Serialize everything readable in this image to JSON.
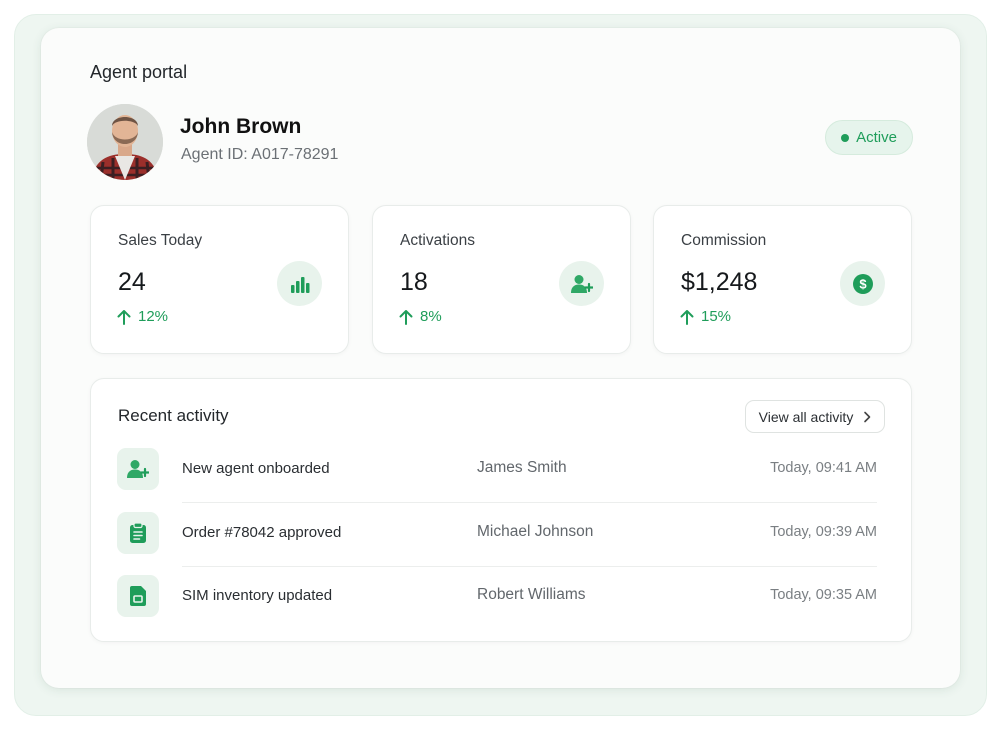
{
  "portal": {
    "title": "Agent portal"
  },
  "agent": {
    "name": "John Brown",
    "agent_id": "Agent ID: A017-78291",
    "status": "Active",
    "avatar_icon": "user-photo"
  },
  "stats": [
    {
      "label": "Sales Today",
      "value": "24",
      "change": "12%",
      "trend_icon": "arrow-up-icon",
      "icon": "bar-chart-icon"
    },
    {
      "label": "Activations",
      "value": "18",
      "change": "8%",
      "trend_icon": "arrow-up-icon",
      "icon": "user-plus-icon"
    },
    {
      "label": "Commission",
      "value": "$1,248",
      "change": "15%",
      "trend_icon": "arrow-up-icon",
      "icon": "dollar-icon"
    }
  ],
  "activity": {
    "title": "Recent activity",
    "view_all_label": "View all activity",
    "items": [
      {
        "event": "New agent onboarded",
        "person": "James Smith",
        "time": "Today, 09:41 AM",
        "icon": "user-plus-icon"
      },
      {
        "event": "Order #78042 approved",
        "person": "Michael Johnson",
        "time": "Today, 09:39 AM",
        "icon": "clipboard-icon"
      },
      {
        "event": "SIM inventory updated",
        "person": "Robert Williams",
        "time": "Today, 09:35 AM",
        "icon": "sim-card-icon"
      }
    ]
  },
  "colors": {
    "accent": "#1f9d5a",
    "accent_bg": "#e8f3ec",
    "page_bg": "#eef6f1"
  }
}
